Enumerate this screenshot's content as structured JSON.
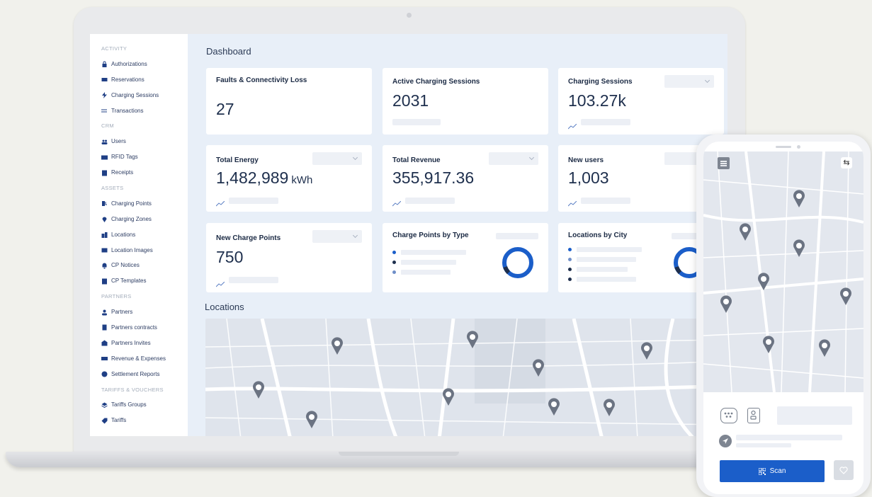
{
  "sidebar": {
    "items": [
      {
        "type": "section",
        "label": "ACTIVITY"
      },
      {
        "type": "item",
        "label": "Authorizations",
        "icon": "lock-icon"
      },
      {
        "type": "item",
        "label": "Reservations",
        "icon": "ticket-icon"
      },
      {
        "type": "item",
        "label": "Charging Sessions",
        "icon": "bolt-icon"
      },
      {
        "type": "item",
        "label": "Transactions",
        "icon": "swap-icon"
      },
      {
        "type": "section",
        "label": "CRM"
      },
      {
        "type": "item",
        "label": "Users",
        "icon": "users-icon"
      },
      {
        "type": "item",
        "label": "RFID Tags",
        "icon": "id-card-icon"
      },
      {
        "type": "item",
        "label": "Receipts",
        "icon": "receipt-icon"
      },
      {
        "type": "section",
        "label": "ASSETS"
      },
      {
        "type": "item",
        "label": "Charging Points",
        "icon": "charger-icon"
      },
      {
        "type": "item",
        "label": "Charging Zones",
        "icon": "pin-icon"
      },
      {
        "type": "item",
        "label": "Locations",
        "icon": "buildings-icon"
      },
      {
        "type": "item",
        "label": "Location Images",
        "icon": "image-icon"
      },
      {
        "type": "item",
        "label": "CP Notices",
        "icon": "bell-icon"
      },
      {
        "type": "item",
        "label": "CP Templates",
        "icon": "document-icon"
      },
      {
        "type": "section",
        "label": "PARTNERS"
      },
      {
        "type": "item",
        "label": "Partners",
        "icon": "user-icon"
      },
      {
        "type": "item",
        "label": "Partners contracts",
        "icon": "contract-icon"
      },
      {
        "type": "item",
        "label": "Partners Invites",
        "icon": "invite-icon"
      },
      {
        "type": "item",
        "label": "Revenue & Expenses",
        "icon": "money-icon"
      },
      {
        "type": "item",
        "label": "Settlement Reports",
        "icon": "badge-icon"
      },
      {
        "type": "section",
        "label": "TARIFFS & VOUCHERS"
      },
      {
        "type": "item",
        "label": "Tariffs Groups",
        "icon": "layers-icon"
      },
      {
        "type": "item",
        "label": "Tariffs",
        "icon": "tag-icon"
      }
    ]
  },
  "dashboard": {
    "title": "Dashboard",
    "cards": {
      "faults": {
        "title": "Faults & Connectivity Loss",
        "value": "27"
      },
      "active_sessions": {
        "title": "Active Charging Sessions",
        "value": "2031"
      },
      "charging_sessions": {
        "title": "Charging Sessions",
        "value": "103.27k"
      },
      "total_energy": {
        "title": "Total Energy",
        "value": "1,482,989",
        "unit": "kWh"
      },
      "total_revenue": {
        "title": "Total Revenue",
        "value": "355,917.36"
      },
      "new_users": {
        "title": "New users",
        "value": "1,003"
      },
      "new_charge_points": {
        "title": "New Charge Points",
        "value": "750"
      },
      "cp_by_type": {
        "title": "Charge Points by Type"
      },
      "locations_by_city": {
        "title": "Locations by City"
      }
    },
    "locations_title": "Locations"
  },
  "phone": {
    "scan_label": "Scan"
  },
  "colors": {
    "accent": "#1b5ec9",
    "navy": "#1f3f85",
    "map": "#dfe4ec"
  }
}
